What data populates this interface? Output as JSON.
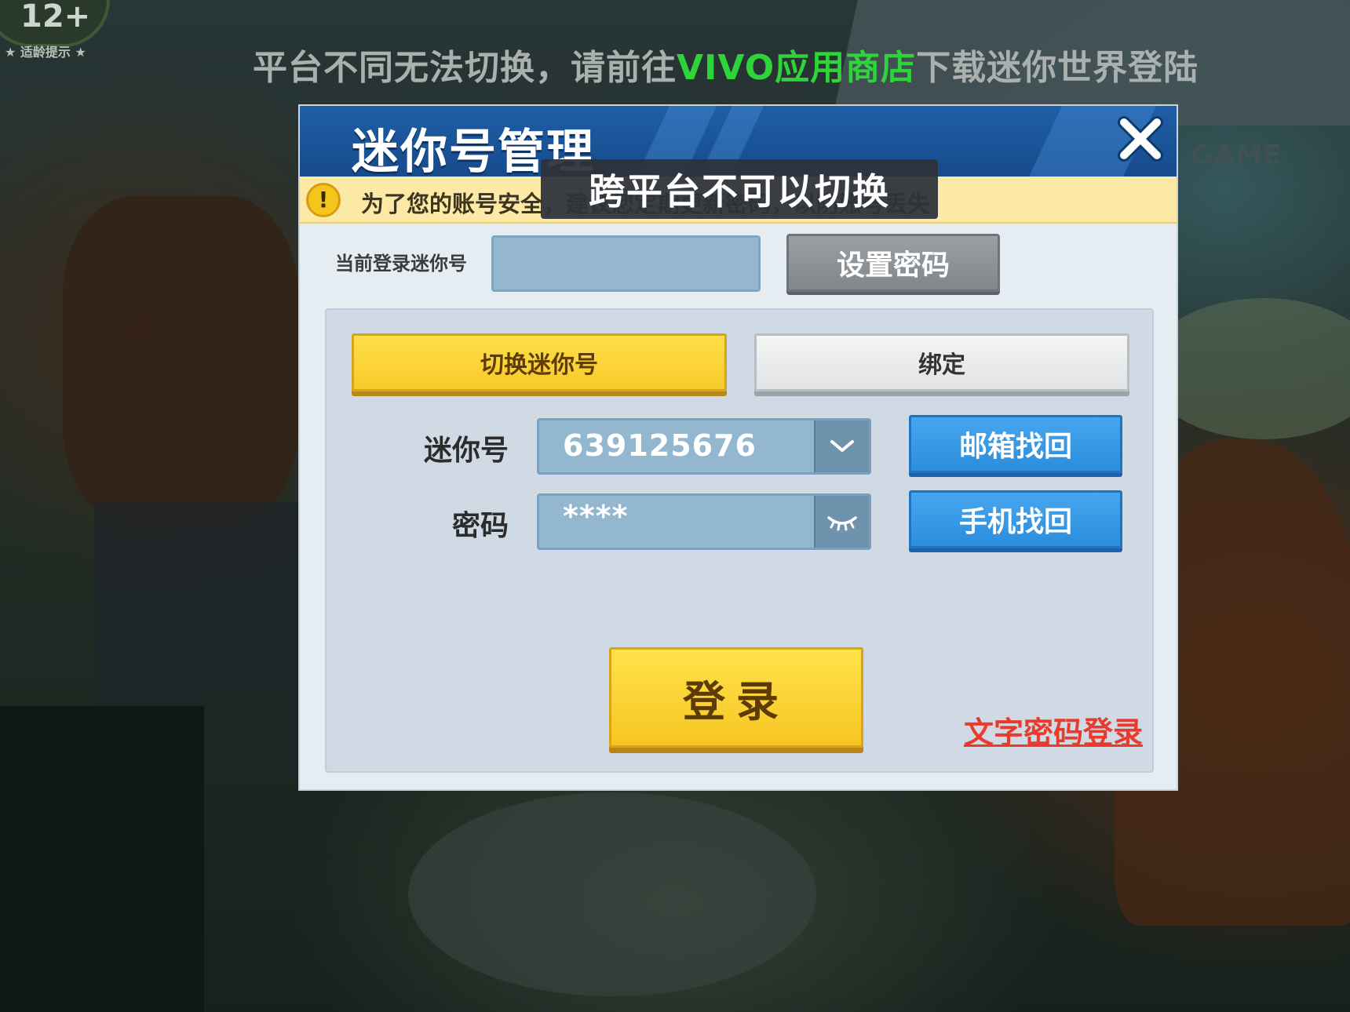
{
  "top_notice": {
    "part1": "平台不同无法切换，请前往",
    "highlight": "VIVO应用商店",
    "part2": "下载迷你世界登陆",
    "highlight_color": "#2fd43a"
  },
  "age_badge": {
    "number": "12+",
    "tip": "★ 适龄提示 ★"
  },
  "background": {
    "brand_text": "GAME"
  },
  "dialog": {
    "title": "迷你号管理",
    "warning": "为了您的账号安全，建议您定期更新密码，以防账号丢失",
    "toast": "跨平台不可以切换",
    "current_label": "当前登录迷你号",
    "current_value": "",
    "set_password_label": "设置密码",
    "tabs": [
      {
        "label": "切换迷你号",
        "active": true
      },
      {
        "label": "绑定",
        "active": false
      }
    ],
    "mini_id_label": "迷你号",
    "mini_id_value": "639125676",
    "password_label": "密码",
    "password_value": "****",
    "recover_email_label": "邮箱找回",
    "recover_phone_label": "手机找回",
    "login_label": "登录",
    "text_password_login_label": "文字密码登录"
  },
  "colors": {
    "header_blue": "#1f5ea6",
    "yellow_button": "#f7c92a",
    "blue_button": "#2b8ddc",
    "link_red": "#ea3a2c",
    "warning_bg": "#fde9a6"
  },
  "icons": [
    "close-icon",
    "warning-icon",
    "chevron-down-icon",
    "eye-closed-icon"
  ]
}
